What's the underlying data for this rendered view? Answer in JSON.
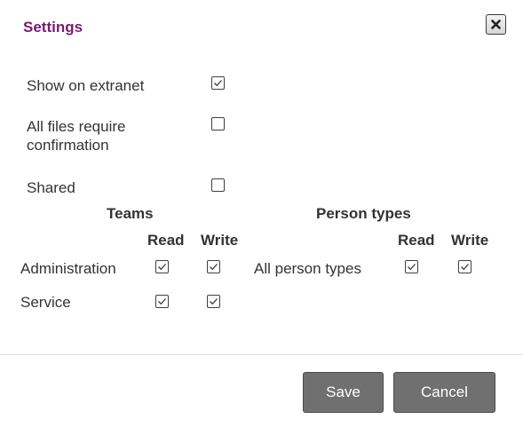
{
  "dialog": {
    "title": "Settings",
    "close_label": "close"
  },
  "options": [
    {
      "label": "Show on extranet",
      "checked": true
    },
    {
      "label": "All files require confirmation",
      "checked": false
    },
    {
      "label": "Shared",
      "checked": false
    }
  ],
  "teams": {
    "heading": "Teams",
    "read_label": "Read",
    "write_label": "Write",
    "rows": [
      {
        "name": "Administration",
        "read": true,
        "write": true
      },
      {
        "name": "Service",
        "read": true,
        "write": true
      }
    ]
  },
  "person_types": {
    "heading": "Person types",
    "read_label": "Read",
    "write_label": "Write",
    "rows": [
      {
        "name": "All person types",
        "read": true,
        "write": true
      }
    ]
  },
  "footer": {
    "save_label": "Save",
    "cancel_label": "Cancel"
  },
  "colors": {
    "title": "#7a1a73",
    "button_bg": "#707070",
    "text": "#333333"
  }
}
